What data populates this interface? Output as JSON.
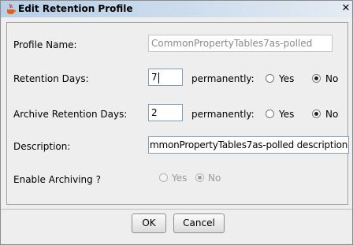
{
  "window": {
    "title": "Edit Retention Profile",
    "icon": "java-cup-icon",
    "close": "✕"
  },
  "form": {
    "profile_name": {
      "label": "Profile Name:",
      "value": "CommonPropertyTables7as-polled"
    },
    "retention_days": {
      "label": "Retention Days:",
      "value": "7",
      "permanently_label": "permanently:",
      "yes_label": "Yes",
      "no_label": "No",
      "selected": "No"
    },
    "archive_retention_days": {
      "label": "Archive Retention Days:",
      "value": "2",
      "permanently_label": "permanently:",
      "yes_label": "Yes",
      "no_label": "No",
      "selected": "No"
    },
    "description": {
      "label": "Description:",
      "value": "mmonPropertyTables7as-polled description"
    },
    "enable_archiving": {
      "label": "Enable Archiving ?",
      "yes_label": "Yes",
      "no_label": "No",
      "selected": "No",
      "enabled": false
    }
  },
  "buttons": {
    "ok": "OK",
    "cancel": "Cancel"
  }
}
